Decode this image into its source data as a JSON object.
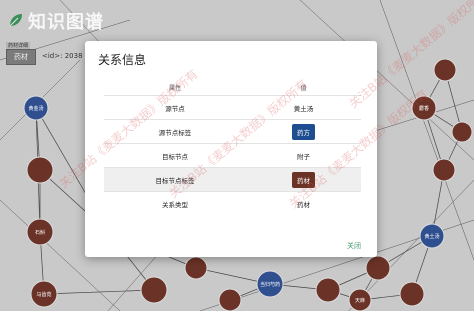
{
  "app": {
    "title": "知识图谱"
  },
  "id_chip": {
    "text": "药材",
    "label": "药材详细"
  },
  "id_text": "<id>: 2038",
  "graph_nodes": [
    {
      "label": "黄金汤",
      "color": "#2f4f8f"
    },
    {
      "label": "石斛",
      "color": "#6b3327"
    },
    {
      "label": "",
      "color": "#6b3327"
    },
    {
      "label": "马齿苋",
      "color": "#6b3327"
    },
    {
      "label": "",
      "color": "#6b3327"
    },
    {
      "label": "",
      "color": "#6b3327"
    },
    {
      "label": "麝香",
      "color": "#6b3327"
    },
    {
      "label": "",
      "color": "#6b3327"
    },
    {
      "label": "黄土汤",
      "color": "#2f4f8f"
    },
    {
      "label": "",
      "color": "#6b3327"
    },
    {
      "label": "",
      "color": "#6b3327"
    },
    {
      "label": "",
      "color": "#6b3327"
    },
    {
      "label": "当归芍药",
      "color": "#2f4f8f"
    },
    {
      "label": "",
      "color": "#6b3327"
    },
    {
      "label": "",
      "color": "#6b3327"
    },
    {
      "label": "",
      "color": "#6b3327"
    },
    {
      "label": "",
      "color": "#6b3327"
    },
    {
      "label": "天麻",
      "color": "#6b3327"
    }
  ],
  "modal": {
    "title": "关系信息",
    "header": {
      "key": "属性",
      "value": "值"
    },
    "rows": [
      {
        "key": "源节点",
        "value": "黄土汤",
        "type": "text"
      },
      {
        "key": "源节点标签",
        "value": "药方",
        "type": "tag-blue"
      },
      {
        "key": "目标节点",
        "value": "附子",
        "type": "text"
      },
      {
        "key": "目标节点标签",
        "value": "药材",
        "type": "tag-brown"
      },
      {
        "key": "关系类型",
        "value": "药材",
        "type": "text"
      }
    ],
    "close_label": "关闭"
  },
  "watermarks": [
    "关注B站《麦麦大数据》版权所有",
    "关注B站《麦麦大数据》版权所有",
    "关注B站《麦麦大数据》版权所有",
    "关注B站《麦麦大数据》版权所有"
  ],
  "colors": {
    "herb": "#6b3327",
    "formula": "#2f4f8f",
    "accent": "#3d9a6d"
  }
}
